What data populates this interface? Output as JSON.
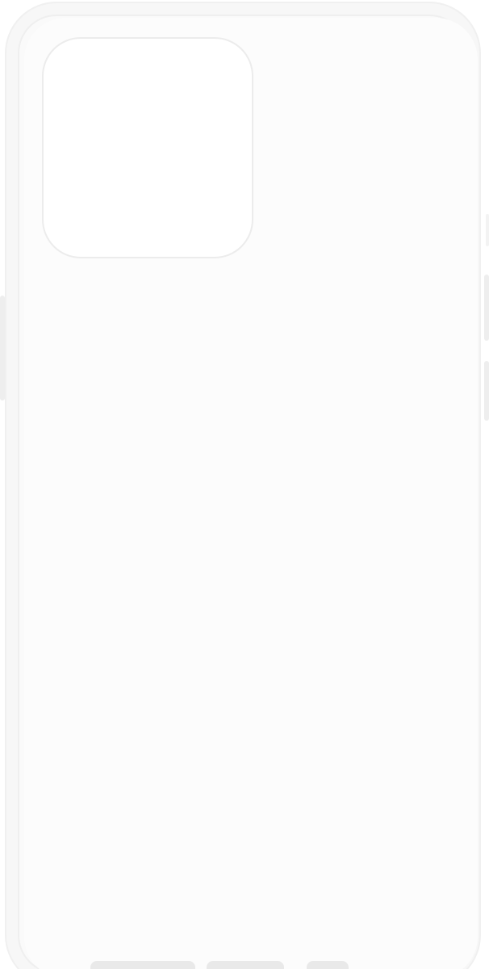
{
  "image": {
    "subject": "clear-phone-case",
    "colors": {
      "background": "#ffffff",
      "case_body": "#fafafa",
      "case_edge": "#efefef",
      "button_covers": "#eeeeee"
    }
  }
}
